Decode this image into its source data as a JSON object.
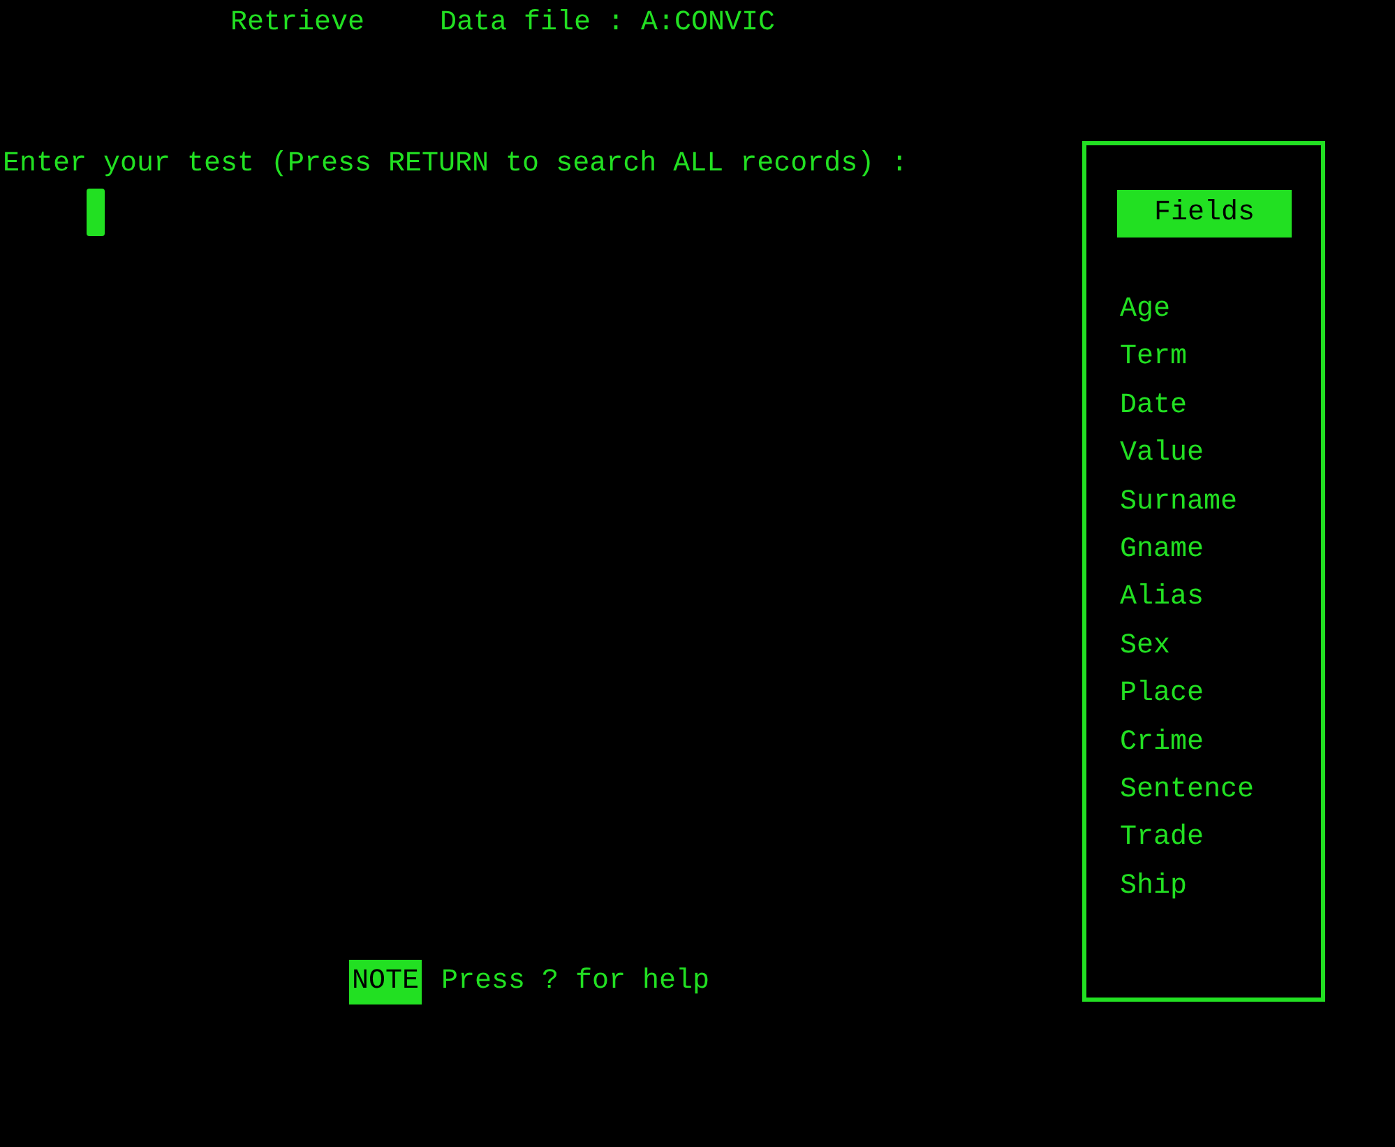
{
  "header": {
    "mode": "Retrieve",
    "data_file": "Data file : A:CONVIC"
  },
  "prompt": "Enter your test (Press RETURN to search ALL records) :",
  "fields_panel": {
    "heading": "Fields",
    "items": [
      "Age",
      "Term",
      "Date",
      "Value",
      "Surname",
      "Gname",
      "Alias",
      "Sex",
      "Place",
      "Crime",
      "Sentence",
      "Trade",
      "Ship"
    ]
  },
  "note": {
    "badge": "NOTE",
    "text": "Press ? for help"
  }
}
